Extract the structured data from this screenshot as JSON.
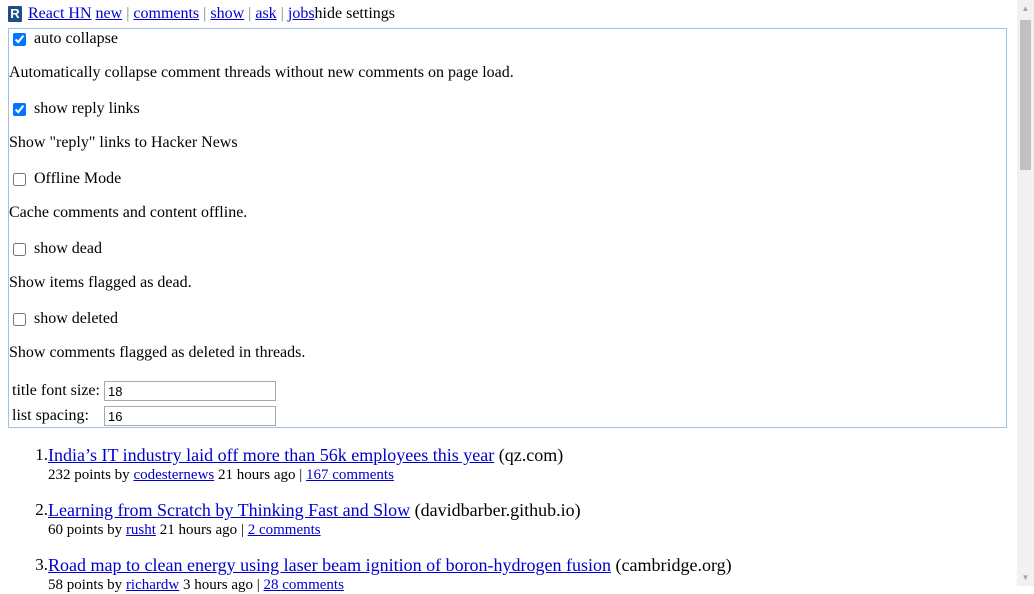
{
  "header": {
    "logo_letter": "R",
    "app_name": "React HN",
    "nav": [
      "new",
      "comments",
      "show",
      "ask",
      "jobs"
    ],
    "hide_settings": "hide settings"
  },
  "settings": {
    "options": [
      {
        "label": "auto collapse",
        "checked": true,
        "description": "Automatically collapse comment threads without new comments on page load."
      },
      {
        "label": "show reply links",
        "checked": true,
        "description": "Show \"reply\" links to Hacker News"
      },
      {
        "label": "Offline Mode",
        "checked": false,
        "description": "Cache comments and content offline."
      },
      {
        "label": "show dead",
        "checked": false,
        "description": "Show items flagged as dead."
      },
      {
        "label": "show deleted",
        "checked": false,
        "description": "Show comments flagged as deleted in threads."
      }
    ],
    "title_font_size": {
      "label": "title font size:",
      "value": "18"
    },
    "list_spacing": {
      "label": "list spacing:",
      "value": "16"
    }
  },
  "stories": [
    {
      "rank": "1.",
      "title": "India’s IT industry laid off more than 56k employees this year",
      "domain": "(qz.com)",
      "points": "232 points by",
      "user": "codesternews",
      "age": "21 hours ago",
      "sep": "|",
      "comments": "167 comments"
    },
    {
      "rank": "2.",
      "title": "Learning from Scratch by Thinking Fast and Slow",
      "domain": "(davidbarber.github.io)",
      "points": "60 points by",
      "user": "rusht",
      "age": "21 hours ago",
      "sep": "|",
      "comments": "2 comments"
    },
    {
      "rank": "3.",
      "title": "Road map to clean energy using laser beam ignition of boron-hydrogen fusion",
      "domain": "(cambridge.org)",
      "points": "58 points by",
      "user": "richardw",
      "age": "3 hours ago",
      "sep": "|",
      "comments": "28 comments"
    }
  ],
  "colors": {
    "link": "#0000cc",
    "panel_border": "#9fc1e6",
    "logo_bg": "#1d4e89",
    "separator": "#828282"
  }
}
